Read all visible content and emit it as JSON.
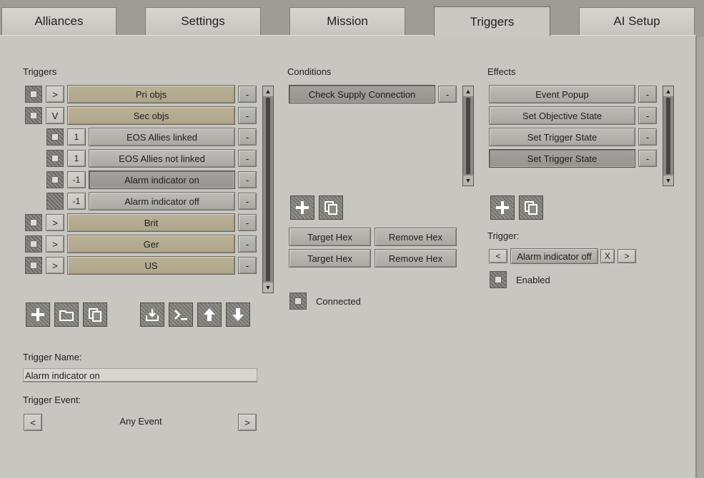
{
  "tabs": [
    {
      "label": "Alliances"
    },
    {
      "label": "Settings"
    },
    {
      "label": "Mission"
    },
    {
      "label": "Triggers"
    },
    {
      "label": "AI Setup"
    }
  ],
  "triggers": {
    "heading": "Triggers",
    "rows": [
      {
        "toggle": ">",
        "label": "Pri objs",
        "remove": "-"
      },
      {
        "toggle": "V",
        "label": "Sec objs",
        "remove": "-"
      },
      {
        "toggle": "1",
        "label": "EOS Allies linked",
        "remove": "-"
      },
      {
        "toggle": "1",
        "label": "EOS Allies not linked",
        "remove": "-"
      },
      {
        "toggle": "-1",
        "label": "Alarm indicator on",
        "remove": "-"
      },
      {
        "toggle": "-1",
        "label": "Alarm indicator off",
        "remove": "-"
      },
      {
        "toggle": ">",
        "label": "Brit",
        "remove": "-"
      },
      {
        "toggle": ">",
        "label": "Ger",
        "remove": "-"
      },
      {
        "toggle": ">",
        "label": "US",
        "remove": "-"
      }
    ],
    "name_label": "Trigger Name:",
    "name_value": "Alarm indicator on",
    "event_label": "Trigger Event:",
    "event_prev": "<",
    "event_value": "Any Event",
    "event_next": ">"
  },
  "conditions": {
    "heading": "Conditions",
    "items": [
      {
        "label": "Check Supply Connection",
        "remove": "-"
      }
    ],
    "target_hex": "Target Hex",
    "remove_hex": "Remove Hex",
    "connected_label": "Connected"
  },
  "effects": {
    "heading": "Effects",
    "items": [
      {
        "label": "Event Popup",
        "remove": "-"
      },
      {
        "label": "Set Objective State",
        "remove": "-"
      },
      {
        "label": "Set Trigger State",
        "remove": "-"
      },
      {
        "label": "Set Trigger State",
        "remove": "-"
      }
    ],
    "trigger_label": "Trigger:",
    "trigger_prev": "<",
    "trigger_value": "Alarm indicator off",
    "trigger_clear": "X",
    "trigger_next": ">",
    "enabled_label": "Enabled"
  }
}
